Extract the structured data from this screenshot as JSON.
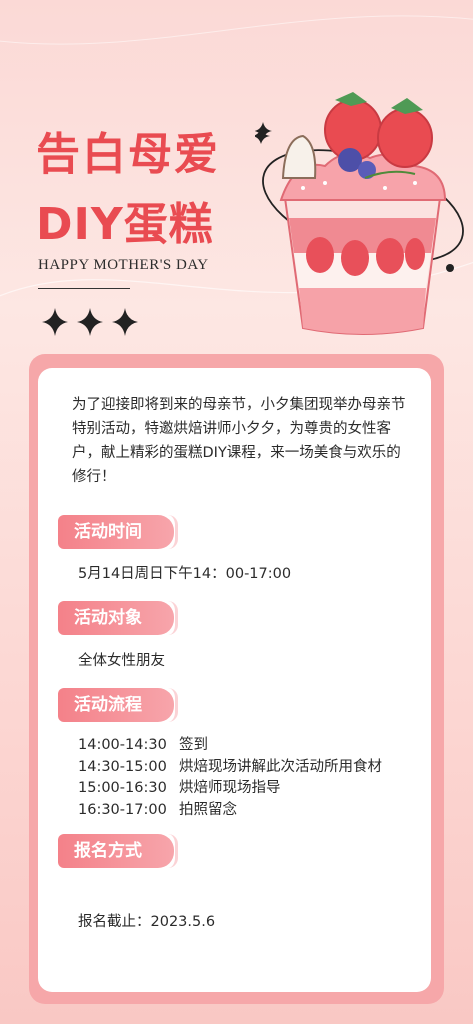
{
  "header": {
    "title_line1": "告白母爱",
    "title_line2": "DIY蛋糕",
    "subtitle": "HAPPY MOTHER'S DAY"
  },
  "intro": "为了迎接即将到来的母亲节，小夕集团现举办母亲节特别活动，特邀烘焙讲师小夕夕，为尊贵的女性客户，献上精彩的蛋糕DIY课程，来一场美食与欢乐的修行！",
  "sections": {
    "time": {
      "label": "活动时间",
      "value": "5月14日周日下午14：00-17:00"
    },
    "audience": {
      "label": "活动对象",
      "value": "全体女性朋友"
    },
    "flow": {
      "label": "活动流程",
      "items": [
        {
          "time": "14:00-14:30",
          "desc": "签到"
        },
        {
          "time": "14:30-15:00",
          "desc": "烘焙现场讲解此次活动所用食材"
        },
        {
          "time": "15:00-16:30",
          "desc": "烘焙师现场指导"
        },
        {
          "time": "16:30-17:00",
          "desc": "拍照留念"
        }
      ]
    },
    "signup": {
      "label": "报名方式",
      "value": "报名截止：2023.5.6"
    }
  },
  "colors": {
    "title": "#e94b51",
    "tag": "#f48189",
    "card_border": "#f6a7a9"
  }
}
